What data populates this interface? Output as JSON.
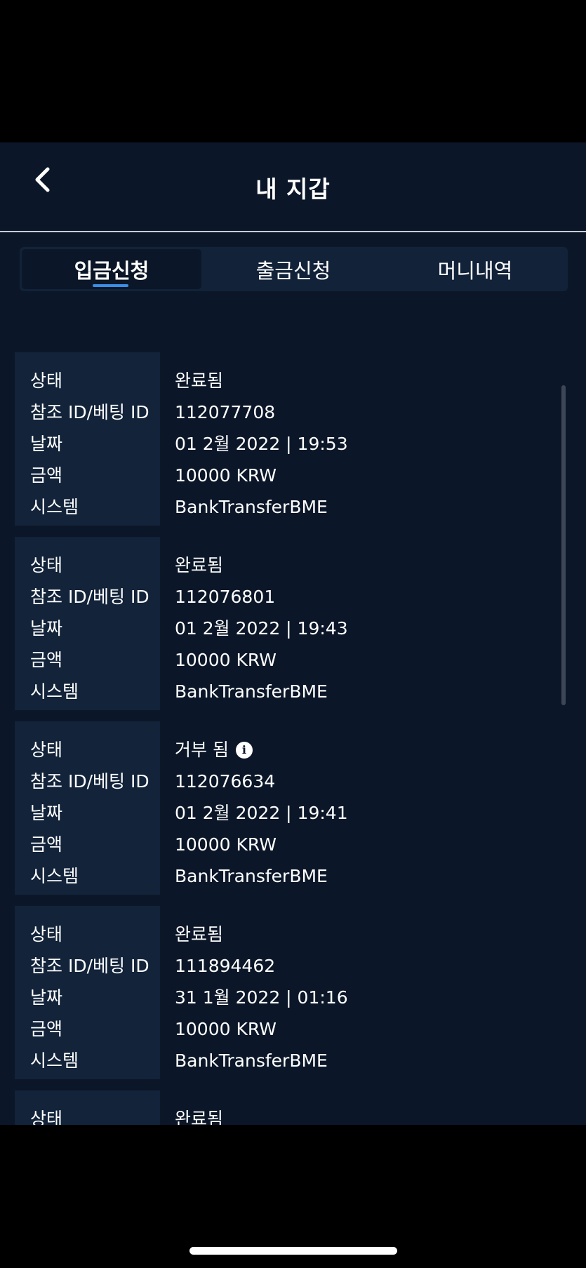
{
  "header": {
    "title": "내 지갑"
  },
  "tabs": [
    {
      "label": "입금신청",
      "active": true
    },
    {
      "label": "출금신청",
      "active": false
    },
    {
      "label": "머니내역",
      "active": false
    }
  ],
  "field_labels": {
    "status": "상태",
    "ref_id": "참조 ID/베팅 ID",
    "date": "날짜",
    "amount": "금액",
    "system": "시스템"
  },
  "transactions": [
    {
      "status": "완료됨",
      "ref_id": "112077708",
      "date": "01 2월 2022 | 19:53",
      "amount": "10000 KRW",
      "system": "BankTransferBME",
      "has_info": false
    },
    {
      "status": "완료됨",
      "ref_id": "112076801",
      "date": "01 2월 2022 | 19:43",
      "amount": "10000 KRW",
      "system": "BankTransferBME",
      "has_info": false
    },
    {
      "status": "거부 됨",
      "ref_id": "112076634",
      "date": "01 2월 2022 | 19:41",
      "amount": "10000 KRW",
      "system": "BankTransferBME",
      "has_info": true
    },
    {
      "status": "완료됨",
      "ref_id": "111894462",
      "date": "31 1월 2022 | 01:16",
      "amount": "10000 KRW",
      "system": "BankTransferBME",
      "has_info": false
    },
    {
      "status": "완료됨",
      "ref_id": "",
      "date": "",
      "amount": "",
      "system": "",
      "has_info": false
    }
  ],
  "icons": {
    "back": "chevron-left-icon",
    "info": "info-icon"
  },
  "colors": {
    "background": "#0b1728",
    "panel": "#12233a",
    "accent": "#3b8ee6"
  }
}
